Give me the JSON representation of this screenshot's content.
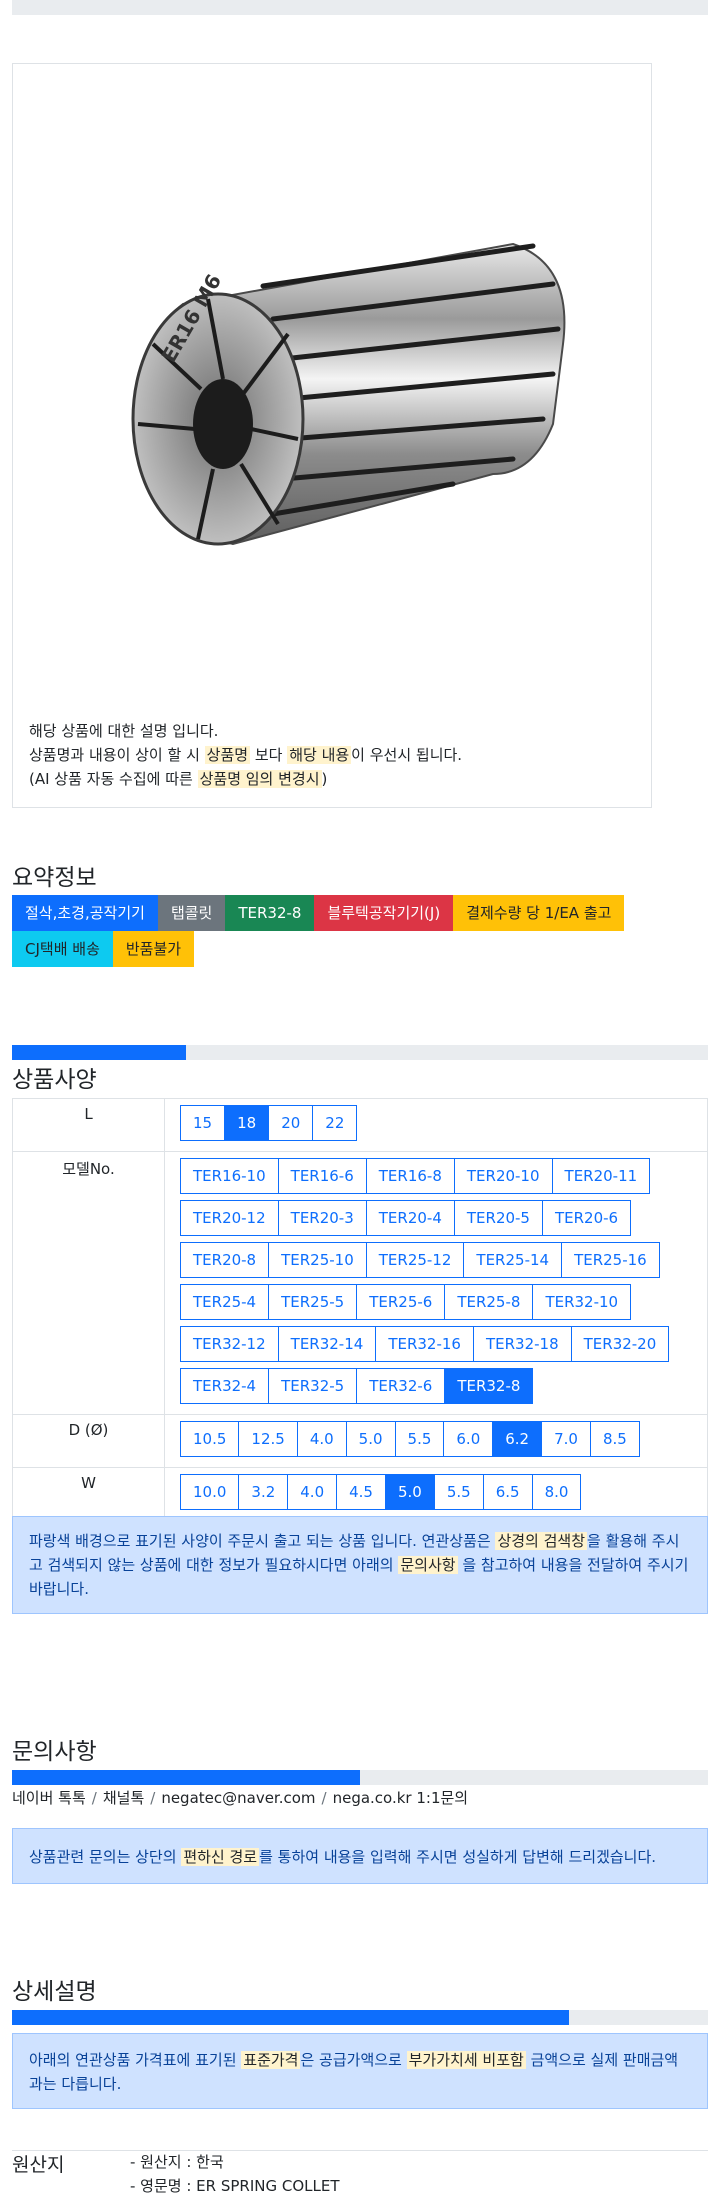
{
  "description": {
    "line1": "해당 상품에 대한 설명 입니다.",
    "line2_a": "상품명과 내용이 상이 할 시 ",
    "line2_hl1": "상품명",
    "line2_b": " 보다 ",
    "line2_hl2": "해당 내용",
    "line2_c": "이 우선시 됩니다.",
    "line3_a": "(AI 상품 자동 수집에 따른 ",
    "line3_hl": "상품명 임의 변경시",
    "line3_b": ")"
  },
  "summary": {
    "title": "요약정보",
    "badges": [
      {
        "label": "절삭,초경,공작기기",
        "color": "#0d6efd"
      },
      {
        "label": "탭콜릿",
        "color": "#6c757d"
      },
      {
        "label": "TER32-8",
        "color": "#198754"
      },
      {
        "label": "블루텍공작기기(J)",
        "color": "#dc3545"
      },
      {
        "label": "결제수량 당 1/EA 출고",
        "color": "#ffc107"
      },
      {
        "label": "CJ택배 배송",
        "color": "#0dcaf0"
      },
      {
        "label": "반품불가",
        "color": "#ffc107"
      }
    ]
  },
  "specs": {
    "title": "상품사양",
    "rows": [
      {
        "key": "L",
        "options": [
          "15",
          "18",
          "20",
          "22"
        ],
        "selected": "18"
      },
      {
        "key": "모델No.",
        "options": [
          "TER16-10",
          "TER16-6",
          "TER16-8",
          "TER20-10",
          "TER20-11",
          "TER20-12",
          "TER20-3",
          "TER20-4",
          "TER20-5",
          "TER20-6",
          "TER20-8",
          "TER25-10",
          "TER25-12",
          "TER25-14",
          "TER25-16",
          "TER25-4",
          "TER25-5",
          "TER25-6",
          "TER25-8",
          "TER32-10",
          "TER32-12",
          "TER32-14",
          "TER32-16",
          "TER32-18",
          "TER32-20",
          "TER32-4",
          "TER32-5",
          "TER32-6",
          "TER32-8"
        ],
        "selected": "TER32-8"
      },
      {
        "key": "D (Ø)",
        "options": [
          "10.5",
          "12.5",
          "4.0",
          "5.0",
          "5.5",
          "6.0",
          "6.2",
          "7.0",
          "8.5"
        ],
        "selected": "6.2"
      },
      {
        "key": "W",
        "options": [
          "10.0",
          "3.2",
          "4.0",
          "4.5",
          "5.0",
          "5.5",
          "6.5",
          "8.0"
        ],
        "selected": "5.0"
      }
    ],
    "notice_a": "파랑색 배경으로 표기된 사양이 주문시 출고 되는 상품 입니다. 연관상품은 ",
    "notice_hl1": "상경의 검색창",
    "notice_b": "을 활용해 주시고 검색되지 않는 상품에 대한 정보가 필요하시다면 아래의 ",
    "notice_hl2": "문의사항",
    "notice_c": " 을 참고하여 내용을 전달하여 주시기 바랍니다."
  },
  "inquiry": {
    "title": "문의사항",
    "progress": 0.5,
    "contacts": [
      "네이버 톡톡",
      "채널톡",
      "negatec@naver.com",
      "nega.co.kr 1:1문의"
    ],
    "notice_a": "상품관련 문의는 상단의 ",
    "notice_hl": "편하신 경로",
    "notice_b": "를 통하여 내용을 입력해 주시면 성실하게 답변해 드리겠습니다."
  },
  "detail": {
    "title": "상세설명",
    "progress": 0.8,
    "notice_a": "아래의 연관상품 가격표에 표기된 ",
    "notice_hl1": "표준가격",
    "notice_b": "은 공급가액으로 ",
    "notice_hl2": "부가가치세 비포함",
    "notice_c": " 금액으로 실제 판매금액과는 다릅니다."
  },
  "specs_progress": 0.25,
  "origin": {
    "label": "원산지",
    "country": "- 원산지 : 한국",
    "english_name": "- 영문명 : ER SPRING COLLET"
  },
  "image_engraving": "ER16 M6"
}
